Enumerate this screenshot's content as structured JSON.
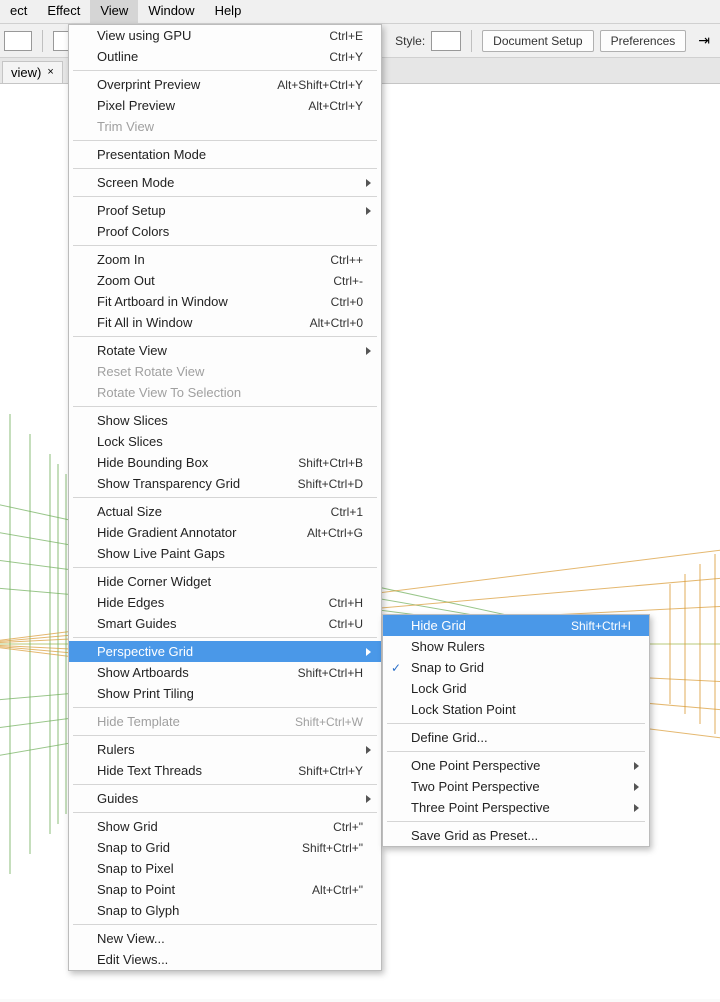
{
  "menubar": {
    "items": [
      "ect",
      "Effect",
      "View",
      "Window",
      "Help"
    ]
  },
  "toolbar": {
    "style_label": "Style:",
    "doc_setup": "Document Setup",
    "preferences": "Preferences"
  },
  "tab": {
    "title": "view)",
    "close": "×"
  },
  "menu_main": [
    {
      "t": "item",
      "label": "View using GPU",
      "kb": "Ctrl+E"
    },
    {
      "t": "item",
      "label": "Outline",
      "kb": "Ctrl+Y"
    },
    {
      "t": "sep"
    },
    {
      "t": "item",
      "label": "Overprint Preview",
      "kb": "Alt+Shift+Ctrl+Y"
    },
    {
      "t": "item",
      "label": "Pixel Preview",
      "kb": "Alt+Ctrl+Y"
    },
    {
      "t": "item",
      "label": "Trim View",
      "disabled": true
    },
    {
      "t": "sep"
    },
    {
      "t": "item",
      "label": "Presentation Mode"
    },
    {
      "t": "sep"
    },
    {
      "t": "item",
      "label": "Screen Mode",
      "sub": true
    },
    {
      "t": "sep"
    },
    {
      "t": "item",
      "label": "Proof Setup",
      "sub": true
    },
    {
      "t": "item",
      "label": "Proof Colors"
    },
    {
      "t": "sep"
    },
    {
      "t": "item",
      "label": "Zoom In",
      "kb": "Ctrl++"
    },
    {
      "t": "item",
      "label": "Zoom Out",
      "kb": "Ctrl+-"
    },
    {
      "t": "item",
      "label": "Fit Artboard in Window",
      "kb": "Ctrl+0"
    },
    {
      "t": "item",
      "label": "Fit All in Window",
      "kb": "Alt+Ctrl+0"
    },
    {
      "t": "sep"
    },
    {
      "t": "item",
      "label": "Rotate View",
      "sub": true
    },
    {
      "t": "item",
      "label": "Reset Rotate View",
      "disabled": true
    },
    {
      "t": "item",
      "label": "Rotate View To Selection",
      "disabled": true
    },
    {
      "t": "sep"
    },
    {
      "t": "item",
      "label": "Show Slices"
    },
    {
      "t": "item",
      "label": "Lock Slices"
    },
    {
      "t": "item",
      "label": "Hide Bounding Box",
      "kb": "Shift+Ctrl+B"
    },
    {
      "t": "item",
      "label": "Show Transparency Grid",
      "kb": "Shift+Ctrl+D"
    },
    {
      "t": "sep"
    },
    {
      "t": "item",
      "label": "Actual Size",
      "kb": "Ctrl+1"
    },
    {
      "t": "item",
      "label": "Hide Gradient Annotator",
      "kb": "Alt+Ctrl+G"
    },
    {
      "t": "item",
      "label": "Show Live Paint Gaps"
    },
    {
      "t": "sep"
    },
    {
      "t": "item",
      "label": "Hide Corner Widget"
    },
    {
      "t": "item",
      "label": "Hide Edges",
      "kb": "Ctrl+H"
    },
    {
      "t": "item",
      "label": "Smart Guides",
      "kb": "Ctrl+U"
    },
    {
      "t": "sep"
    },
    {
      "t": "item",
      "label": "Perspective Grid",
      "sub": true,
      "hl": true
    },
    {
      "t": "item",
      "label": "Show Artboards",
      "kb": "Shift+Ctrl+H"
    },
    {
      "t": "item",
      "label": "Show Print Tiling"
    },
    {
      "t": "sep"
    },
    {
      "t": "item",
      "label": "Hide Template",
      "kb": "Shift+Ctrl+W",
      "disabled": true
    },
    {
      "t": "sep"
    },
    {
      "t": "item",
      "label": "Rulers",
      "sub": true
    },
    {
      "t": "item",
      "label": "Hide Text Threads",
      "kb": "Shift+Ctrl+Y"
    },
    {
      "t": "sep"
    },
    {
      "t": "item",
      "label": "Guides",
      "sub": true
    },
    {
      "t": "sep"
    },
    {
      "t": "item",
      "label": "Show Grid",
      "kb": "Ctrl+\""
    },
    {
      "t": "item",
      "label": "Snap to Grid",
      "kb": "Shift+Ctrl+\""
    },
    {
      "t": "item",
      "label": "Snap to Pixel"
    },
    {
      "t": "item",
      "label": "Snap to Point",
      "kb": "Alt+Ctrl+\""
    },
    {
      "t": "item",
      "label": "Snap to Glyph"
    },
    {
      "t": "sep"
    },
    {
      "t": "item",
      "label": "New View..."
    },
    {
      "t": "item",
      "label": "Edit Views..."
    }
  ],
  "menu_sub": [
    {
      "t": "item",
      "label": "Hide Grid",
      "kb": "Shift+Ctrl+I",
      "hl": true
    },
    {
      "t": "item",
      "label": "Show Rulers"
    },
    {
      "t": "item",
      "label": "Snap to Grid",
      "check": true
    },
    {
      "t": "item",
      "label": "Lock Grid"
    },
    {
      "t": "item",
      "label": "Lock Station Point"
    },
    {
      "t": "sep"
    },
    {
      "t": "item",
      "label": "Define Grid..."
    },
    {
      "t": "sep"
    },
    {
      "t": "item",
      "label": "One Point Perspective",
      "sub": true
    },
    {
      "t": "item",
      "label": "Two Point Perspective",
      "sub": true
    },
    {
      "t": "item",
      "label": "Three Point Perspective",
      "sub": true
    },
    {
      "t": "sep"
    },
    {
      "t": "item",
      "label": "Save Grid as Preset..."
    }
  ]
}
